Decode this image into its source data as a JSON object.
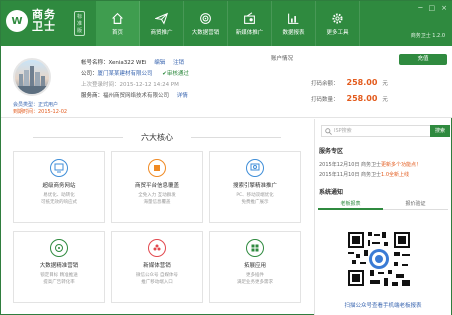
{
  "app": {
    "logo_mark": "W",
    "logo_line1": "商务",
    "logo_line2": "卫士",
    "logo_badge": "标准版",
    "version": "商务卫士 1.2.0",
    "controls": [
      "─",
      "□",
      "×"
    ]
  },
  "nav": [
    {
      "label": "首页",
      "icon": "home-icon",
      "active": true
    },
    {
      "label": "商贸推广",
      "icon": "paper-plane-icon",
      "active": false
    },
    {
      "label": "大数据营销",
      "icon": "target-icon",
      "active": false
    },
    {
      "label": "新媒体推广",
      "icon": "radio-icon",
      "active": false
    },
    {
      "label": "数据报表",
      "icon": "chart-icon",
      "active": false
    },
    {
      "label": "更多工具",
      "icon": "gear-icon",
      "active": false
    }
  ],
  "user": {
    "member_type": "会员类型：正式用户",
    "expire": "到期时间：2015-12-02",
    "account_label": "帐号名称：",
    "account_name": "Xenia322 WEi",
    "edit": "编辑",
    "logout": "注销",
    "company_label": "公司：",
    "company": "厦门某某建材有限公司",
    "auth": "审核通过",
    "last_login": "上次登录时间：2015-12-12 14:24 PM",
    "service_label": "服务商：",
    "service": "福州商贸网络技术有限公司",
    "detail": "详情"
  },
  "account": {
    "title": "账户情况",
    "balance_label": "打码余额：",
    "balance_value": "258.00",
    "balance_unit": "元",
    "count_label": "打码数量：",
    "count_value": "258.00",
    "count_unit": "元",
    "recharge": "充值"
  },
  "core": {
    "title": "六大核心",
    "cards": [
      {
        "title": "超级商务网站",
        "desc": "易优化、助转化\n可抵无效的响应式",
        "color": "#3f8ed8",
        "icon": "monitor-icon"
      },
      {
        "title": "商贸平台信息覆盖",
        "desc": "全免入力 互动群发\n海量信息覆盖",
        "color": "#f08a24",
        "icon": "layers-icon"
      },
      {
        "title": "搜索引擎精准推广",
        "desc": "PC、移动双端优化\n免费推广展示",
        "color": "#3f8ed8",
        "icon": "search-monitor-icon"
      },
      {
        "title": "大数据精准营销",
        "desc": "锁定目标 精准推送\n提高广告转化率",
        "color": "#2f8a3f",
        "icon": "target-icon"
      },
      {
        "title": "新媒体营销",
        "desc": "微信公众号 自媒体号\n推广移动端入口",
        "color": "#e2484e",
        "icon": "flower-icon"
      },
      {
        "title": "拓展应用",
        "desc": "更多插件\n满足业务更多需求",
        "color": "#2f8a3f",
        "icon": "grid-icon"
      }
    ]
  },
  "sidebar": {
    "search_placeholder": "ISP搜索",
    "search_btn": "搜索",
    "service_title": "服务专区",
    "notices": [
      {
        "text": "2015年12月10日  商务卫士",
        "hl": "更新多个功能点！"
      },
      {
        "text": "2015年11月10日  商务卫士",
        "hl": "1.0全新上线"
      }
    ],
    "notify_title": "系统通知",
    "tabs": [
      "老板报表",
      "报价验证"
    ],
    "qr_caption": "扫描公众号查看手机端老板报表"
  }
}
